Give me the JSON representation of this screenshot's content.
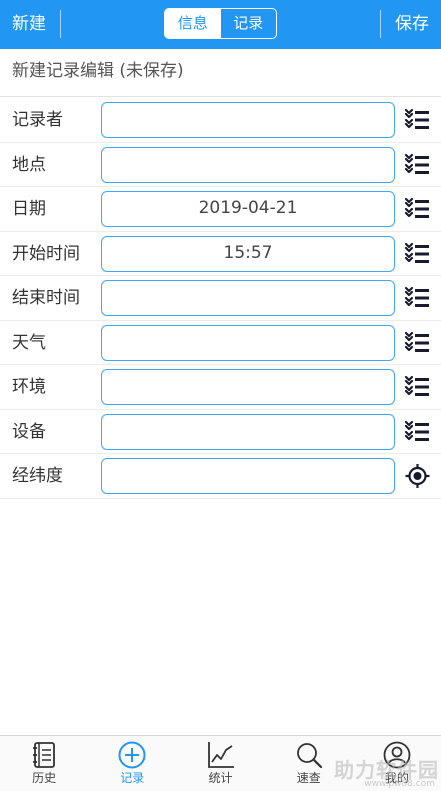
{
  "topbar": {
    "new_label": "新建",
    "save_label": "保存",
    "segments": [
      {
        "label": "信息",
        "active": false
      },
      {
        "label": "记录",
        "active": true
      }
    ]
  },
  "subtitle": "新建记录编辑 (未保存)",
  "form": {
    "rows": [
      {
        "label": "记录者",
        "value": "",
        "icon": "list-picker-icon"
      },
      {
        "label": "地点",
        "value": "",
        "icon": "list-picker-icon"
      },
      {
        "label": "日期",
        "value": "2019-04-21",
        "icon": "list-picker-icon"
      },
      {
        "label": "开始时间",
        "value": "15:57",
        "icon": "list-picker-icon"
      },
      {
        "label": "结束时间",
        "value": "",
        "icon": "list-picker-icon"
      },
      {
        "label": "天气",
        "value": "",
        "icon": "list-picker-icon"
      },
      {
        "label": "环境",
        "value": "",
        "icon": "list-picker-icon"
      },
      {
        "label": "设备",
        "value": "",
        "icon": "list-picker-icon"
      },
      {
        "label": "经纬度",
        "value": "",
        "icon": "locate-icon"
      }
    ]
  },
  "bottomnav": {
    "items": [
      {
        "label": "历史",
        "icon": "history-book-icon",
        "active": false
      },
      {
        "label": "记录",
        "icon": "add-circle-icon",
        "active": true
      },
      {
        "label": "统计",
        "icon": "chart-line-icon",
        "active": false
      },
      {
        "label": "速查",
        "icon": "search-icon",
        "active": false
      },
      {
        "label": "我的",
        "icon": "user-icon",
        "active": false
      }
    ]
  },
  "watermark": {
    "text": "助力软件园",
    "url": "www.pw88.com"
  },
  "colors": {
    "primary": "#2196f3",
    "field_border": "#42a5f5",
    "icon_dark": "#1a1a2e"
  }
}
